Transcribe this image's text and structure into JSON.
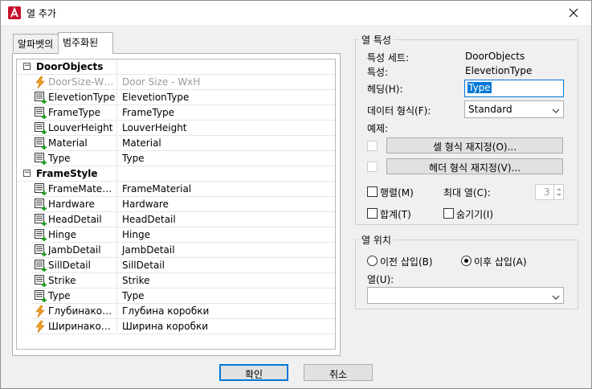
{
  "window": {
    "title": "열 추가"
  },
  "tabs": [
    {
      "label": "알파벳의"
    },
    {
      "label": "범주화된"
    }
  ],
  "tree": {
    "groups": [
      {
        "name": "DoorObjects",
        "rows": [
          {
            "icon": "lightning-icon",
            "name": "DoorSize-WxH",
            "value": "Door Size - WxH",
            "disabled": true
          },
          {
            "icon": "property-list-icon",
            "name": "ElevetionType",
            "value": "ElevetionType"
          },
          {
            "icon": "property-list-icon",
            "name": "FrameType",
            "value": "FrameType"
          },
          {
            "icon": "property-list-icon",
            "name": "LouverHeight",
            "value": "LouverHeight"
          },
          {
            "icon": "property-list-icon",
            "name": "Material",
            "value": "Material"
          },
          {
            "icon": "property-list-icon",
            "name": "Type",
            "value": "Type"
          }
        ]
      },
      {
        "name": "FrameStyle",
        "rows": [
          {
            "icon": "property-list-icon",
            "name": "FrameMaterial",
            "value": "FrameMaterial"
          },
          {
            "icon": "property-list-icon",
            "name": "Hardware",
            "value": "Hardware"
          },
          {
            "icon": "property-list-icon",
            "name": "HeadDetail",
            "value": "HeadDetail"
          },
          {
            "icon": "property-list-icon",
            "name": "Hinge",
            "value": "Hinge"
          },
          {
            "icon": "property-list-icon",
            "name": "JambDetail",
            "value": "JambDetail"
          },
          {
            "icon": "property-list-icon",
            "name": "SillDetail",
            "value": "SillDetail"
          },
          {
            "icon": "property-list-icon",
            "name": "Strike",
            "value": "Strike"
          },
          {
            "icon": "property-list-icon",
            "name": "Type",
            "value": "Type"
          },
          {
            "icon": "lightning-icon",
            "name": "Глубинакоро...",
            "value": "Глубина коробки"
          },
          {
            "icon": "lightning-icon",
            "name": "Ширинакоро...",
            "value": "Ширина коробки"
          }
        ]
      }
    ]
  },
  "column_properties": {
    "legend": "열 특성",
    "property_set_label": "특성 세트:",
    "property_set_value": "DoorObjects",
    "property_label": "특성:",
    "property_value": "ElevetionType",
    "heading_label": "헤딩(H):",
    "heading_value": "Type",
    "data_format_label": "데이터 형식(F):",
    "data_format_value": "Standard",
    "example_label": "예제:",
    "cell_format_override": "셀 형식 재지정(O)...",
    "header_format_override": "헤더 형식 재지정(V)...",
    "matrix_label": "행렬(M)",
    "max_columns_label": "최대 열(C):",
    "max_columns_value": "3",
    "total_label": "합계(T)",
    "hide_label": "숨기기(I)"
  },
  "column_position": {
    "legend": "열 위치",
    "insert_before": "이전 삽입(B)",
    "insert_after": "이후 삽입(A)",
    "column_label": "열(U):",
    "column_value": ""
  },
  "buttons": {
    "ok": "확인",
    "cancel": "취소"
  }
}
